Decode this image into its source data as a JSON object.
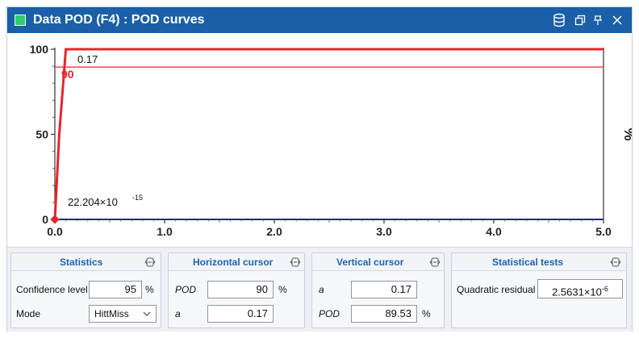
{
  "window": {
    "title": "Data POD (F4) : POD curves",
    "accent_color": "#1a5fa7",
    "icon_color": "#2ecc71",
    "toolbar_icons": [
      "database-icon",
      "restore-icon",
      "pin-icon",
      "close-icon"
    ]
  },
  "chart_data": {
    "type": "line",
    "x_ticks": [
      "0.0",
      "1.0",
      "2.0",
      "3.0",
      "4.0",
      "5.0"
    ],
    "y_ticks": [
      "0",
      "50",
      "100"
    ],
    "xlim": [
      0,
      5
    ],
    "ylim": [
      0,
      100
    ],
    "ylabel": "%",
    "grid": false,
    "series": [
      {
        "x": [
          0.0,
          0.04,
          0.1,
          5.0
        ],
        "y": [
          0,
          50,
          100,
          100
        ],
        "color": "#e8242b"
      }
    ],
    "hline": {
      "y": 89.53,
      "color": "#e8242b"
    },
    "marker_point": {
      "x": 0.0,
      "y": 0,
      "color": "#e8242b"
    },
    "annotations": {
      "hline_x": "0.17",
      "hline_y": "90",
      "marker_label_base": "22.204×10",
      "marker_label_exp": "-15"
    }
  },
  "panels": {
    "statistics": {
      "title": "Statistics",
      "confidence_label": "Confidence level",
      "confidence_value": "95",
      "confidence_unit": "%",
      "mode_label": "Mode",
      "mode_value": "HittMiss"
    },
    "horizontal_cursor": {
      "title": "Horizontal cursor",
      "pod_label": "POD",
      "pod_value": "90",
      "pod_unit": "%",
      "a_label": "a",
      "a_value": "0.17"
    },
    "vertical_cursor": {
      "title": "Vertical cursor",
      "a_label": "a",
      "a_value": "0.17",
      "pod_label": "POD",
      "pod_value": "89.53",
      "pod_unit": "%"
    },
    "statistical_tests": {
      "title": "Statistical tests",
      "residual_label": "Quadratic residual",
      "residual_base": "2.5631×10",
      "residual_exp": "-6"
    }
  }
}
